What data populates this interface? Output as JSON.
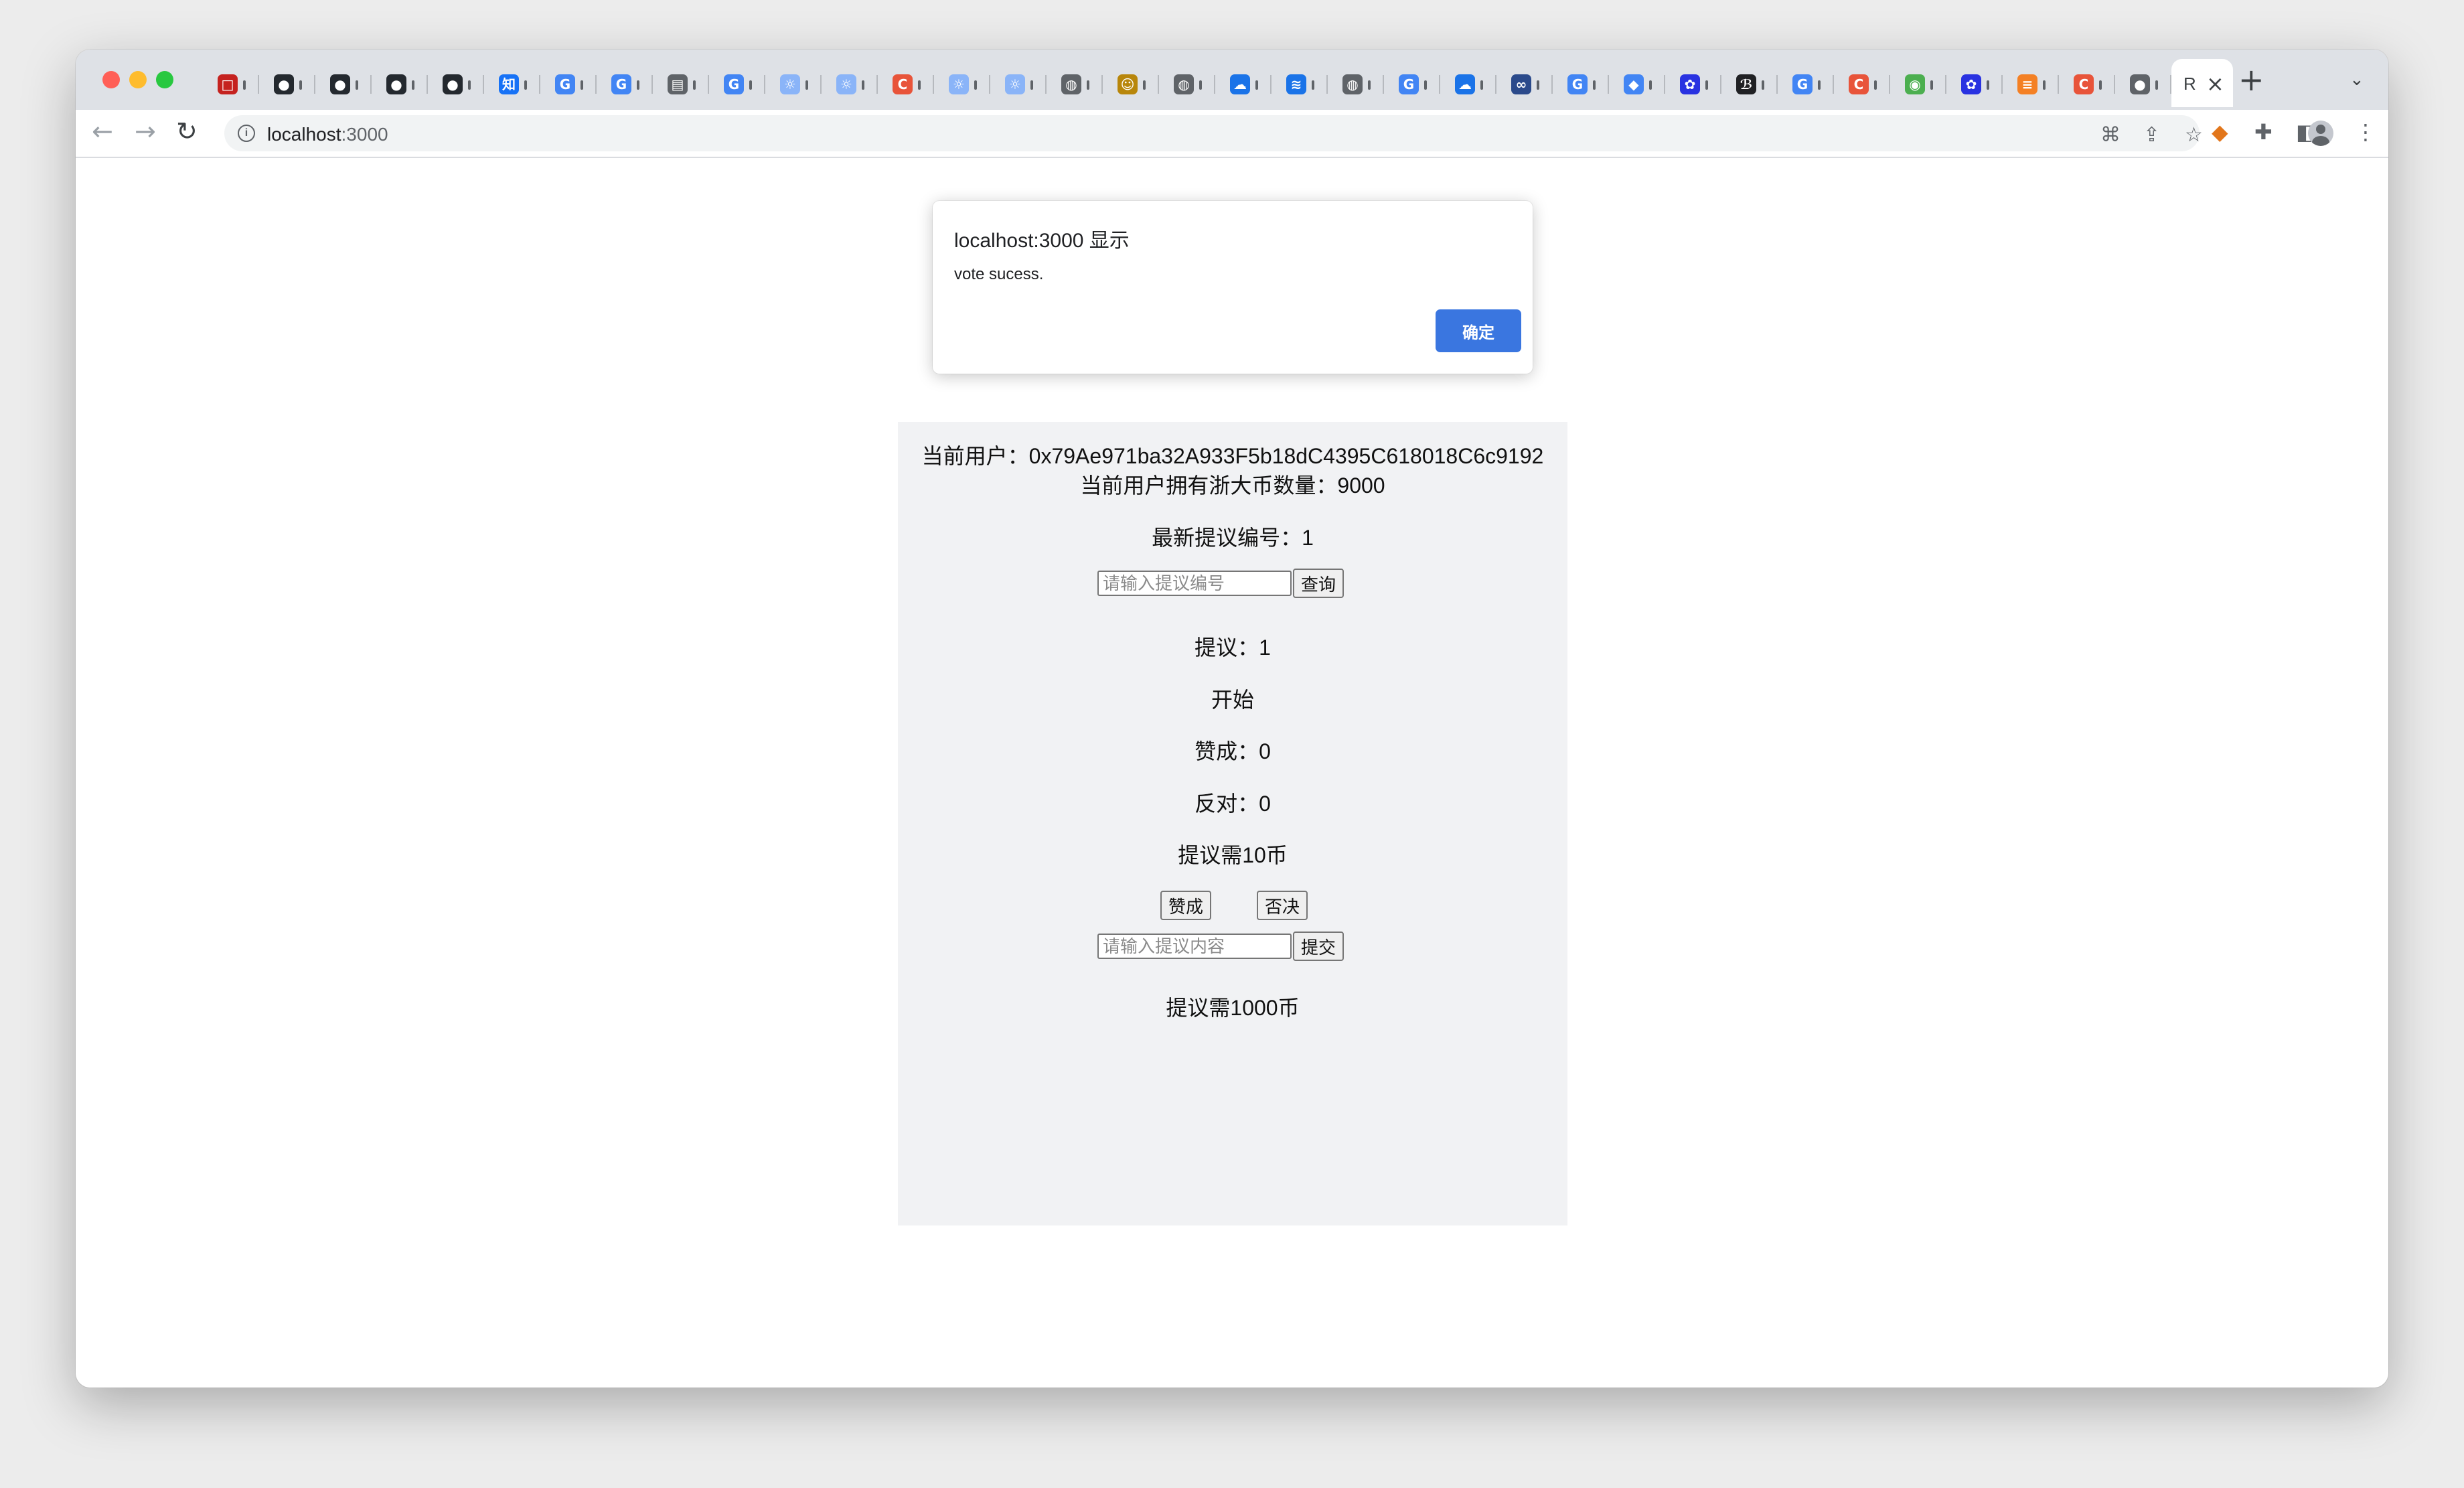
{
  "browser": {
    "active_tab_title": "R",
    "url_host": "localhost",
    "url_port": ":3000",
    "tab_favicons": [
      {
        "icon": "red-square-icon",
        "color": "#c5221f",
        "glyph": "□"
      },
      {
        "icon": "github-icon",
        "color": "#24292f",
        "glyph": "●"
      },
      {
        "icon": "github-icon",
        "color": "#24292f",
        "glyph": "●"
      },
      {
        "icon": "github-icon",
        "color": "#24292f",
        "glyph": "●"
      },
      {
        "icon": "github-icon",
        "color": "#24292f",
        "glyph": "●"
      },
      {
        "icon": "zhihu-icon",
        "color": "#1772f6",
        "glyph": "知"
      },
      {
        "icon": "google-icon",
        "color": "#4285f4",
        "glyph": "G"
      },
      {
        "icon": "google-icon",
        "color": "#4285f4",
        "glyph": "G"
      },
      {
        "icon": "book-icon",
        "color": "#5f6368",
        "glyph": "▤"
      },
      {
        "icon": "google-icon",
        "color": "#4285f4",
        "glyph": "G"
      },
      {
        "icon": "bulb-icon",
        "color": "#8ab4f8",
        "glyph": "☼"
      },
      {
        "icon": "bulb-icon",
        "color": "#8ab4f8",
        "glyph": "☼"
      },
      {
        "icon": "csdn-icon",
        "color": "#e8543a",
        "glyph": "C"
      },
      {
        "icon": "bulb-icon",
        "color": "#8ab4f8",
        "glyph": "☼"
      },
      {
        "icon": "bulb-icon",
        "color": "#8ab4f8",
        "glyph": "☼"
      },
      {
        "icon": "globe-icon",
        "color": "#5f6368",
        "glyph": "◍"
      },
      {
        "icon": "avatar-tab-icon",
        "color": "#b8860b",
        "glyph": "☺"
      },
      {
        "icon": "globe-icon",
        "color": "#5f6368",
        "glyph": "◍"
      },
      {
        "icon": "cloud-icon",
        "color": "#1a73e8",
        "glyph": "☁"
      },
      {
        "icon": "layers-icon",
        "color": "#1a73e8",
        "glyph": "≋"
      },
      {
        "icon": "globe-icon",
        "color": "#5f6368",
        "glyph": "◍"
      },
      {
        "icon": "google-icon",
        "color": "#4285f4",
        "glyph": "G"
      },
      {
        "icon": "cloud-icon",
        "color": "#1a73e8",
        "glyph": "☁"
      },
      {
        "icon": "infinity-icon",
        "color": "#2b4a8b",
        "glyph": "∞"
      },
      {
        "icon": "google-icon",
        "color": "#4285f4",
        "glyph": "G"
      },
      {
        "icon": "diamond-icon",
        "color": "#4285f4",
        "glyph": "◆"
      },
      {
        "icon": "baidu-icon",
        "color": "#2932e1",
        "glyph": "✿"
      },
      {
        "icon": "script-icon",
        "color": "#202124",
        "glyph": "ℬ"
      },
      {
        "icon": "google-icon",
        "color": "#4285f4",
        "glyph": "G"
      },
      {
        "icon": "csdn-icon",
        "color": "#e8543a",
        "glyph": "C"
      },
      {
        "icon": "wechat-icon",
        "color": "#4caf50",
        "glyph": "◉"
      },
      {
        "icon": "baidu-icon",
        "color": "#2932e1",
        "glyph": "✿"
      },
      {
        "icon": "stack-icon",
        "color": "#f48024",
        "glyph": "≡"
      },
      {
        "icon": "csdn-icon",
        "color": "#e8543a",
        "glyph": "C"
      },
      {
        "icon": "apple-icon",
        "color": "#5f6368",
        "glyph": "●"
      }
    ]
  },
  "dialog": {
    "title": "localhost:3000 显示",
    "message": "vote sucess.",
    "ok_label": "确定",
    "ok_color": "#3a76e0"
  },
  "app": {
    "current_user_line": "当前用户：0x79Ae971ba32A933F5b18dC4395C618018C6c9192",
    "balance_line": "当前用户拥有浙大币数量：9000",
    "latest_proposal_line": "最新提议编号：1",
    "query_input_placeholder": "请输入提议编号",
    "query_button_label": "查询",
    "proposal_line": "提议：1",
    "status_line": "开始",
    "approve_count_line": "赞成：0",
    "reject_count_line": "反对：0",
    "vote_cost_line": "提议需10币",
    "approve_button_label": "赞成",
    "reject_button_label": "否决",
    "content_input_placeholder": "请输入提议内容",
    "submit_button_label": "提交",
    "submit_cost_line": "提议需1000币"
  }
}
